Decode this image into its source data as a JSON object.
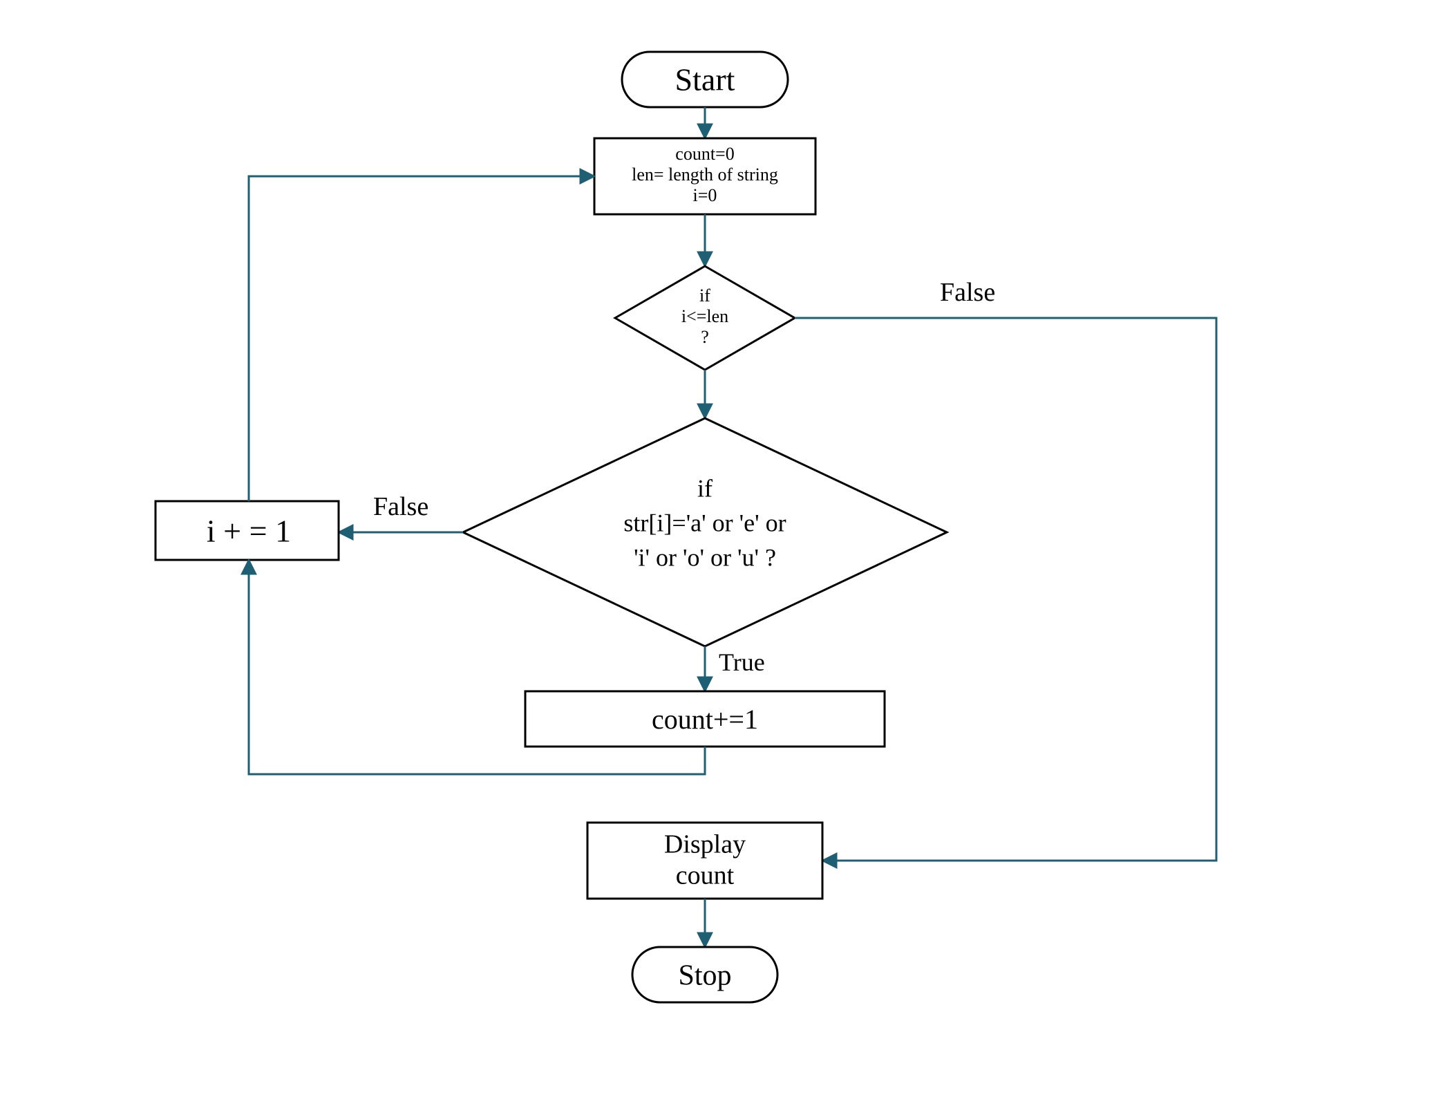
{
  "flowchart": {
    "nodes": {
      "start": {
        "label": "Start"
      },
      "init": {
        "line1": "count=0",
        "line2": "len= length of string",
        "line3": "i=0"
      },
      "cond1": {
        "line1": "if",
        "line2": "i<=len",
        "line3": "?"
      },
      "cond2": {
        "line1": "if",
        "line2": "str[i]='a' or 'e' or",
        "line3": "'i' or 'o' or 'u' ?"
      },
      "increment_i": {
        "label": "i + = 1"
      },
      "increment_count": {
        "label": "count+=1"
      },
      "display": {
        "line1": "Display",
        "line2": "count"
      },
      "stop": {
        "label": "Stop"
      }
    },
    "edge_labels": {
      "cond1_false": "False",
      "cond2_false": "False",
      "cond2_true": "True"
    },
    "colors": {
      "connector": "#1e5f74",
      "stroke": "#000000"
    }
  }
}
